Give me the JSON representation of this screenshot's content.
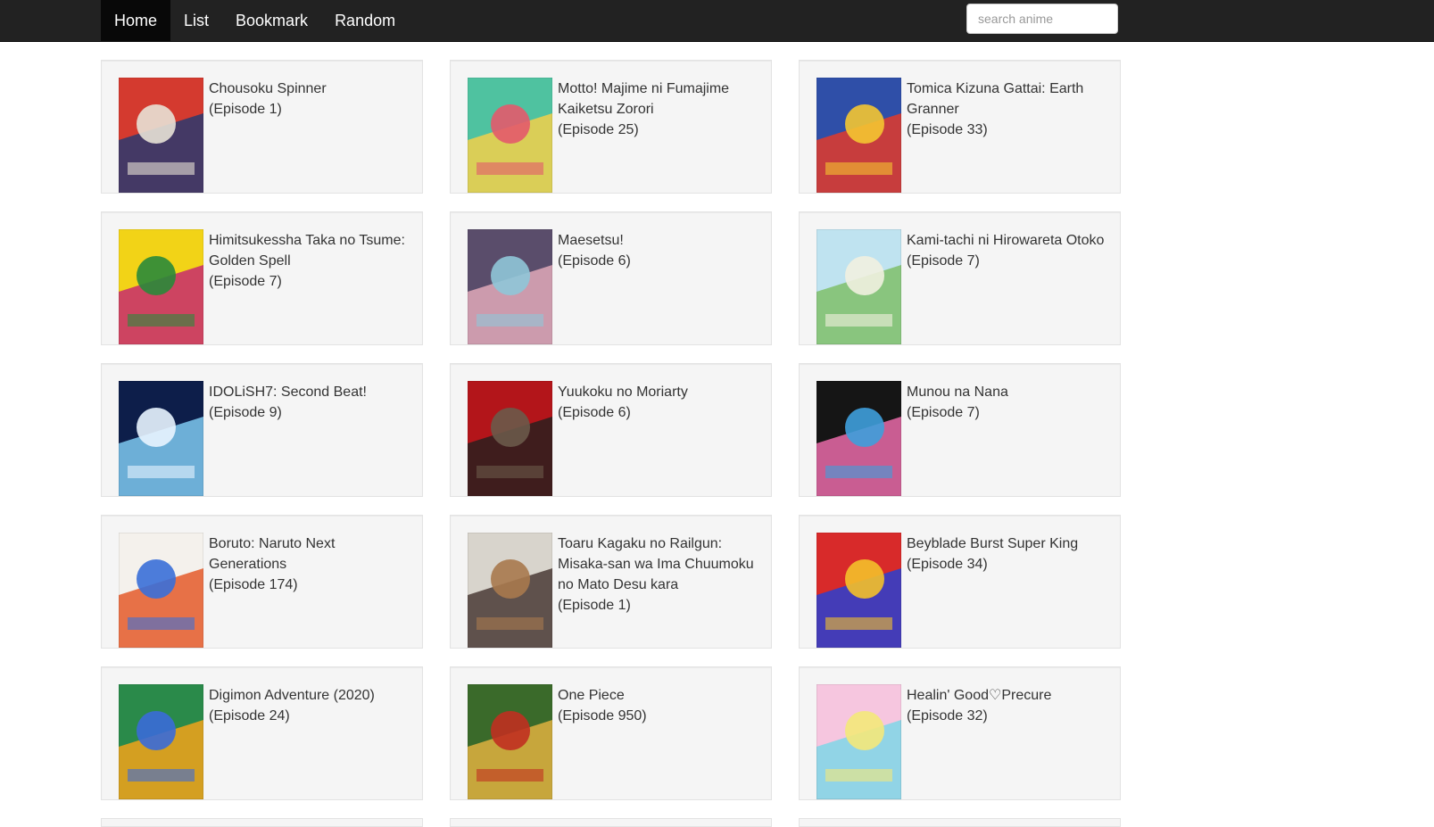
{
  "nav": {
    "items": [
      {
        "label": "Home",
        "active": true
      },
      {
        "label": "List",
        "active": false
      },
      {
        "label": "Bookmark",
        "active": false
      },
      {
        "label": "Random",
        "active": false
      }
    ]
  },
  "search": {
    "placeholder": "search anime",
    "value": ""
  },
  "cards": [
    {
      "title": "Chousoku Spinner",
      "episode": "(Episode 1)",
      "colors": [
        "#d43a2f",
        "#2a3a6e",
        "#e8e2d6"
      ]
    },
    {
      "title": "Motto! Majime ni Fumajime Kaiketsu Zorori",
      "episode": "(Episode 25)",
      "colors": [
        "#4fc2a0",
        "#f2d04a",
        "#e35a6b"
      ]
    },
    {
      "title": "Tomica Kizuna Gattai: Earth Granner",
      "episode": "(Episode 33)",
      "colors": [
        "#2f4fa8",
        "#e23a2a",
        "#f4c531"
      ]
    },
    {
      "title": "Himitsukessha Taka no Tsume: Golden Spell",
      "episode": "(Episode 7)",
      "colors": [
        "#f2d317",
        "#c72a6f",
        "#2a8a3a"
      ]
    },
    {
      "title": "Maesetsu!",
      "episode": "(Episode 6)",
      "colors": [
        "#5a4d6b",
        "#e0a9b8",
        "#8fc7d8"
      ]
    },
    {
      "title": "Kami-tachi ni Hirowareta Otoko",
      "episode": "(Episode 7)",
      "colors": [
        "#bfe3f0",
        "#7fbf6a",
        "#f1f0e0"
      ]
    },
    {
      "title": "IDOLiSH7: Second Beat!",
      "episode": "(Episode 9)",
      "colors": [
        "#0d1e4a",
        "#7fc9f0",
        "#e8f4ff"
      ]
    },
    {
      "title": "Yuukoku no Moriarty",
      "episode": "(Episode 6)",
      "colors": [
        "#b3151a",
        "#2a1f1f",
        "#6a5a4a"
      ]
    },
    {
      "title": "Munou na Nana",
      "episode": "(Episode 7)",
      "colors": [
        "#151515",
        "#e96aa8",
        "#3e9fdc"
      ]
    },
    {
      "title": "Boruto: Naruto Next Generations",
      "episode": "(Episode 174)",
      "colors": [
        "#f4f1ec",
        "#e45a2a",
        "#3a6fd8"
      ]
    },
    {
      "title": "Toaru Kagaku no Railgun: Misaka-san wa Ima Chuumoku no Mato Desu kara",
      "episode": "(Episode 1)",
      "colors": [
        "#d8d4cc",
        "#4a3a35",
        "#a8794e"
      ]
    },
    {
      "title": "Beyblade Burst Super King",
      "episode": "(Episode 34)",
      "colors": [
        "#d82a2a",
        "#2a3fd0",
        "#f4c02a"
      ]
    },
    {
      "title": "Digimon Adventure (2020)",
      "episode": "(Episode 24)",
      "colors": [
        "#2a8a4a",
        "#f2a21a",
        "#3a6ad8"
      ]
    },
    {
      "title": "One Piece",
      "episode": "(Episode 950)",
      "colors": [
        "#3a6a2a",
        "#e0b040",
        "#c03020"
      ]
    },
    {
      "title": "Healin' Good♡Precure",
      "episode": "(Episode 32)",
      "colors": [
        "#f6c6df",
        "#7fd6e8",
        "#f4e87a"
      ]
    }
  ]
}
